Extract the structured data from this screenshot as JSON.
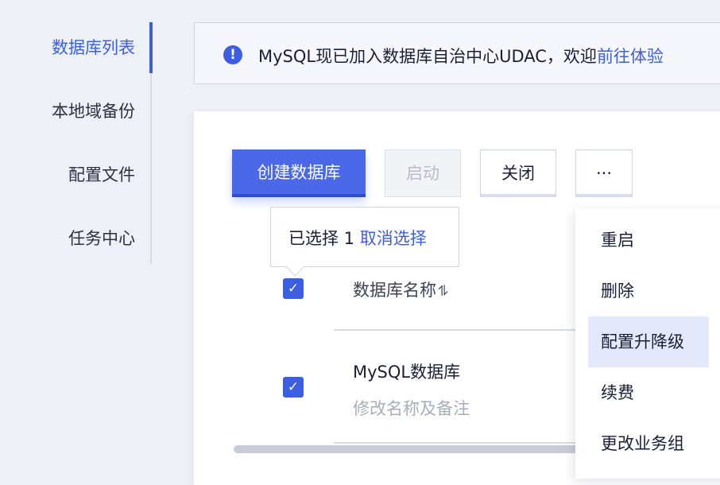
{
  "sidebar": {
    "items": [
      {
        "label": "数据库列表",
        "active": true
      },
      {
        "label": "本地域备份",
        "active": false
      },
      {
        "label": "配置文件",
        "active": false
      },
      {
        "label": "任务中心",
        "active": false
      }
    ]
  },
  "notice": {
    "icon": "!",
    "text": "MySQL现已加入数据库自治中心UDAC，欢迎",
    "link": "前往体验"
  },
  "toolbar": {
    "create_label": "创建数据库",
    "start_label": "启动",
    "close_label": "关闭",
    "more_label": "···"
  },
  "selection_tooltip": {
    "text": "已选择 1 ",
    "clear_link": "取消选择"
  },
  "table": {
    "header": "数据库名称",
    "sort_icon": "⥮",
    "check_mark": "✓",
    "rows": [
      {
        "name": "MySQL数据库",
        "sub": "修改名称及备注"
      }
    ]
  },
  "dropdown": {
    "items": [
      "重启",
      "删除",
      "配置升降级",
      "续费",
      "更改业务组"
    ]
  },
  "colors": {
    "accent": "#3c5ee0",
    "primary_button": "#4a68e8",
    "menu_highlight": "#e4e8fb"
  }
}
